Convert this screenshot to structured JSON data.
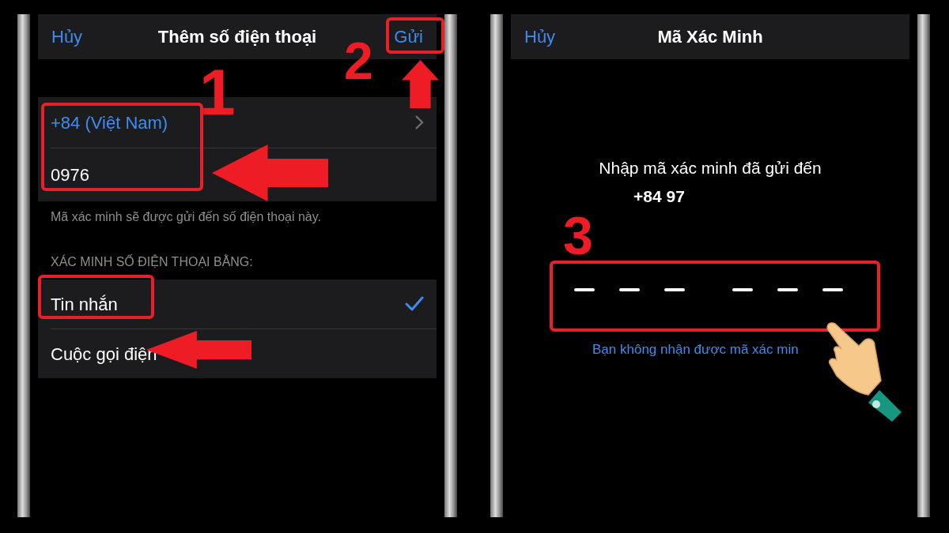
{
  "screens": [
    {
      "kind": "form",
      "nav": {
        "cancel": "Hủy",
        "title": "Thêm số điện thoại",
        "action": "Gửi"
      },
      "country": "+84 (Việt Nam)",
      "phone": "0976",
      "footer": "Mã xác minh sẽ được gửi đến số điện thoại này.",
      "section_header": "XÁC MINH SỐ ĐIỆN THOẠI BẰNG:",
      "options": [
        {
          "label": "Tin nhắn",
          "selected": true
        },
        {
          "label": "Cuộc gọi điện",
          "selected": false
        }
      ]
    },
    {
      "kind": "code",
      "nav": {
        "cancel": "Hủy",
        "title": "Mã Xác Minh"
      },
      "prompt": "Nhập mã xác minh đã gửi đến",
      "number": "+84 97",
      "resend_link": "Bạn không nhận được mã xác min"
    }
  ],
  "steps": [
    "1",
    "2",
    "3"
  ]
}
